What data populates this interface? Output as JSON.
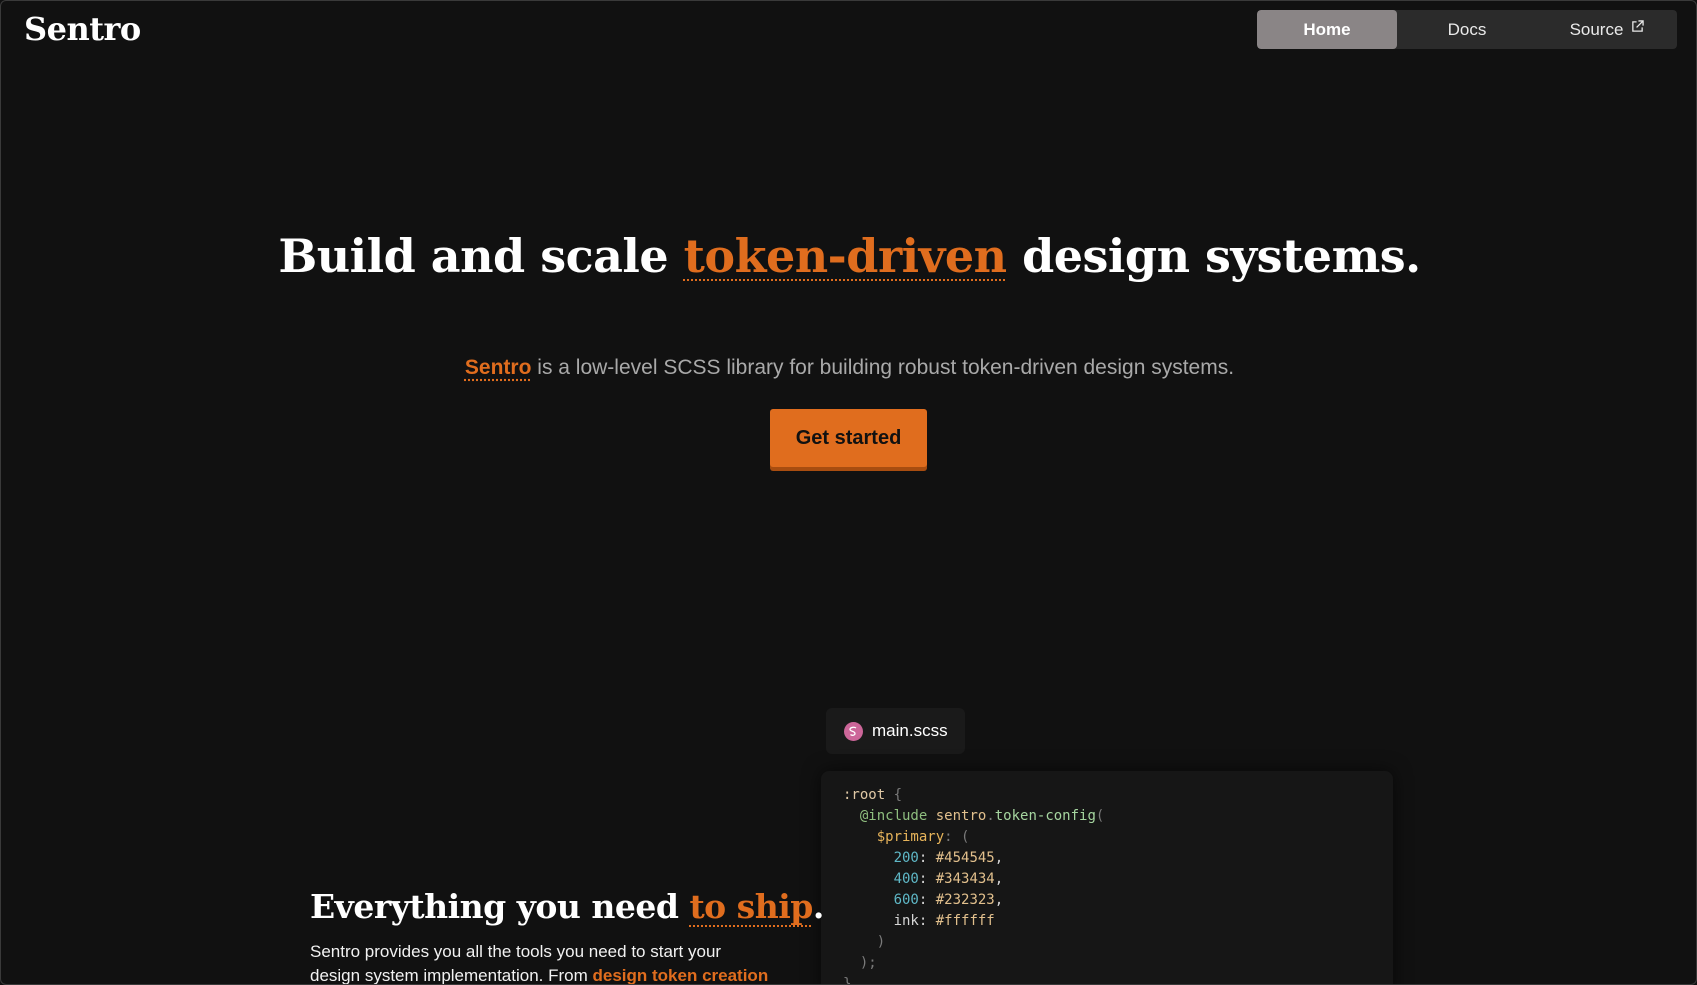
{
  "header": {
    "logo": "Sentro",
    "nav": {
      "home_label": "Home",
      "docs_label": "Docs",
      "source_label": "Source"
    }
  },
  "hero": {
    "title_part1": "Build and scale ",
    "title_accent": "token-driven",
    "title_part2": " design systems.",
    "subtitle_brand": "Sentro",
    "subtitle_rest": " is a low-level SCSS library for building robust token-driven design systems.",
    "cta_label": "Get started"
  },
  "code_sample": {
    "filename": "main.scss",
    "lines": {
      "l1_sel": ":root",
      "l1_brace": " {",
      "l2_kw": "@include",
      "l2_ns": " sentro",
      "l2_dot": ".",
      "l2_fn": "token-config",
      "l2_paren": "(",
      "l3_var": "$primary",
      "l3_rest": ": (",
      "l4_key": "200",
      "l4_val": "#454545",
      "l5_key": "400",
      "l5_val": "#343434",
      "l6_key": "600",
      "l6_val": "#232323",
      "l7_key": "ink",
      "l7_val": "#ffffff",
      "l8": ")",
      "l9": ");",
      "l10": "}"
    }
  },
  "features": {
    "title_part1": "Everything you need ",
    "title_accent": "to ship",
    "title_period": ".",
    "body_line1": "Sentro provides you all the tools you need to start your",
    "body_line2": "design system implementation. From ",
    "body_link": "design token creation"
  },
  "colors": {
    "background": "#111111",
    "accent": "#e06d1e",
    "nav_active": "#8a8586",
    "sass_brand": "#cc6699"
  }
}
